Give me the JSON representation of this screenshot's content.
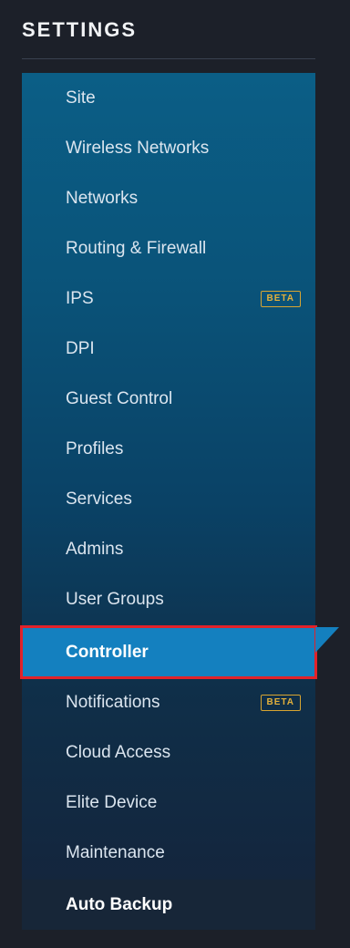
{
  "settings": {
    "title": "SETTINGS",
    "items": [
      {
        "label": "Site",
        "badge": ""
      },
      {
        "label": "Wireless Networks",
        "badge": ""
      },
      {
        "label": "Networks",
        "badge": ""
      },
      {
        "label": "Routing & Firewall",
        "badge": ""
      },
      {
        "label": "IPS",
        "badge": "BETA"
      },
      {
        "label": "DPI",
        "badge": ""
      },
      {
        "label": "Guest Control",
        "badge": ""
      },
      {
        "label": "Profiles",
        "badge": ""
      },
      {
        "label": "Services",
        "badge": ""
      },
      {
        "label": "Admins",
        "badge": ""
      },
      {
        "label": "User Groups",
        "badge": ""
      },
      {
        "label": "Controller",
        "badge": ""
      },
      {
        "label": "Notifications",
        "badge": "BETA"
      },
      {
        "label": "Cloud Access",
        "badge": ""
      },
      {
        "label": "Elite Device",
        "badge": ""
      },
      {
        "label": "Maintenance",
        "badge": ""
      },
      {
        "label": "Auto Backup",
        "badge": ""
      }
    ],
    "selected_item": "Controller"
  },
  "colors": {
    "active_background": "#1480bf",
    "highlight_border": "#e2222a",
    "badge": "#e3b03c"
  }
}
